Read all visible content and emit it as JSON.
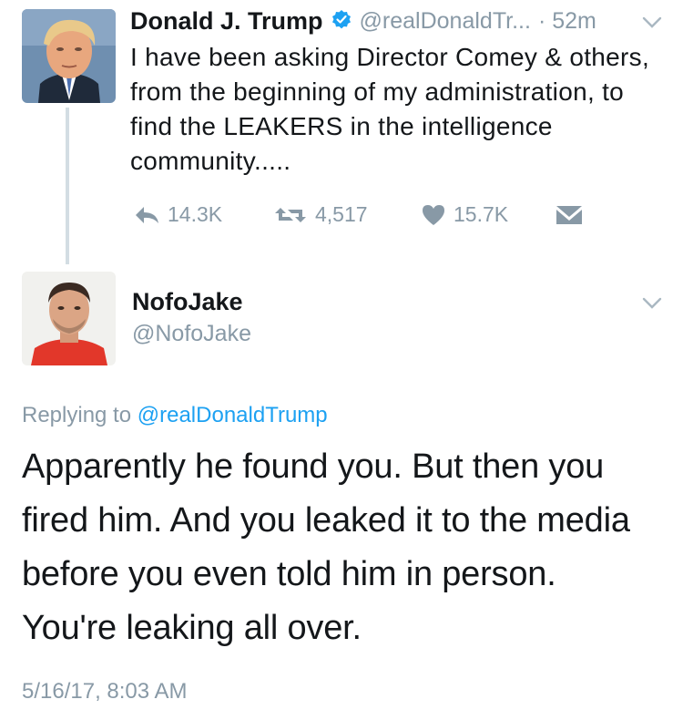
{
  "original_tweet": {
    "author_name": "Donald J. Trump",
    "handle": "@realDonaldTr...",
    "time_ago": "· 52m",
    "text": "I have been asking Director Comey & others, from the beginning of my administration, to find the LEAKERS in the intelligence community.....",
    "actions": {
      "reply_count": "14.3K",
      "retweet_count": "4,517",
      "like_count": "15.7K"
    },
    "verified": true
  },
  "reply_tweet": {
    "author_name": "NofoJake",
    "handle": "@NofoJake",
    "replying_to_prefix": "Replying to",
    "replying_to_handle": "@realDonaldTrump",
    "text": "Apparently he found you. But then you fired him. And you leaked it to the media before you even told him in person. You're leaking all over.",
    "timestamp": "5/16/17, 8:03 AM"
  },
  "colors": {
    "accent": "#1da1f2",
    "muted": "#8899a6",
    "text": "#14171a",
    "thread_line": "#d3dde3"
  },
  "icons": {
    "verified": "verified-badge-icon",
    "reply": "reply-icon",
    "retweet": "retweet-icon",
    "like": "heart-icon",
    "dm": "direct-message-icon",
    "menu": "chevron-down-icon"
  }
}
